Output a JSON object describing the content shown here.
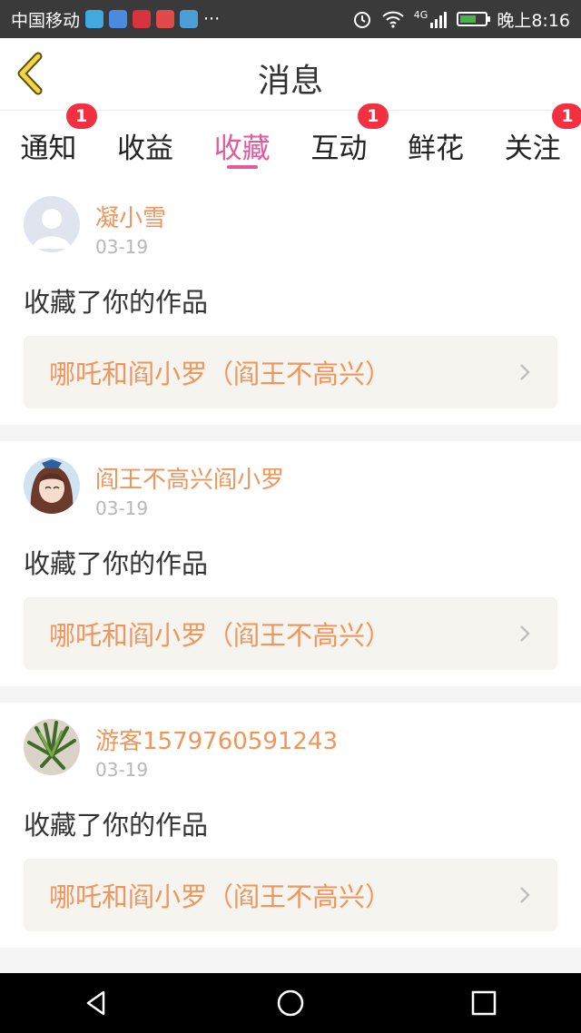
{
  "status_bar": {
    "carrier": "中国移动",
    "more": "···",
    "network": "4G",
    "time": "晚上8:16",
    "battery_level": 0.7,
    "app_icons": [
      "#3fa9e0",
      "#4a8be0",
      "#d9333f",
      "#e14a4a",
      "#4c9fd6"
    ]
  },
  "header": {
    "title": "消息"
  },
  "tabs": [
    {
      "label": "通知",
      "badge": "1"
    },
    {
      "label": "收益",
      "badge": ""
    },
    {
      "label": "收藏",
      "badge": "",
      "active": true
    },
    {
      "label": "互动",
      "badge": "1"
    },
    {
      "label": "鲜花",
      "badge": ""
    },
    {
      "label": "关注",
      "badge": "1"
    }
  ],
  "feed": [
    {
      "username": "凝小雪",
      "date": "03-19",
      "action": "收藏了你的作品",
      "work_title": "哪吒和阎小罗（阎王不高兴）"
    },
    {
      "username": "阎王不高兴阎小罗",
      "date": "03-19",
      "action": "收藏了你的作品",
      "work_title": "哪吒和阎小罗（阎王不高兴）"
    },
    {
      "username": "游客1579760591243",
      "date": "03-19",
      "action": "收藏了你的作品",
      "work_title": "哪吒和阎小罗（阎王不高兴）"
    }
  ],
  "colors": {
    "accent": "#e35a9c",
    "username": "#f0955b",
    "badge": "#f2303f",
    "link_bg": "#f5f4ee"
  }
}
